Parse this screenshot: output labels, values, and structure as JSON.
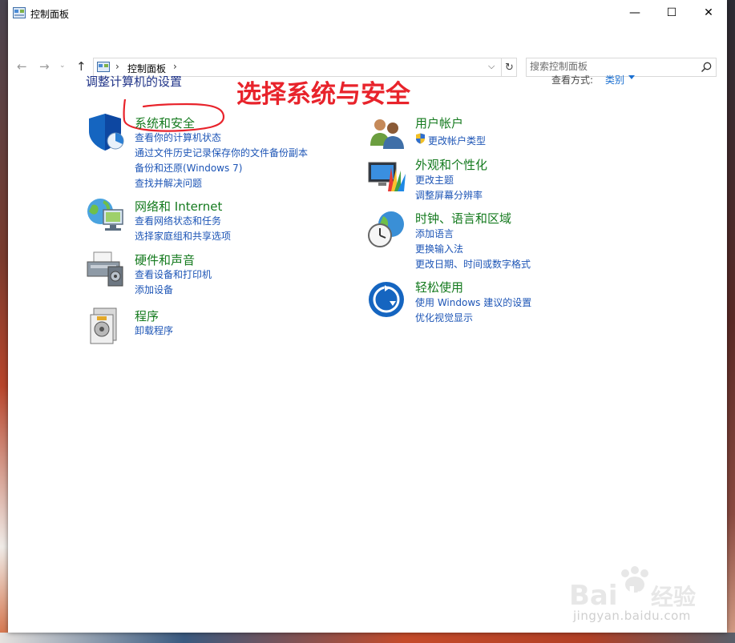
{
  "window": {
    "title": "控制面板",
    "controls": {
      "minimize": "—",
      "maximize": "☐",
      "close": "✕"
    }
  },
  "address": {
    "path": "控制面板",
    "search_placeholder": "搜索控制面板"
  },
  "main": {
    "heading": "调整计算机的设置",
    "view_by_label": "查看方式:",
    "view_by_value": "类别"
  },
  "annotation": {
    "text": "选择系统与安全",
    "color": "#e8232b"
  },
  "categories": [
    {
      "icon": "shield-icon",
      "title": "系统和安全",
      "links": [
        "查看你的计算机状态",
        "通过文件历史记录保存你的文件备份副本",
        "备份和还原(Windows 7)",
        "查找并解决问题"
      ]
    },
    {
      "icon": "network-globe-icon",
      "title": "网络和 Internet",
      "links": [
        "查看网络状态和任务",
        "选择家庭组和共享选项"
      ]
    },
    {
      "icon": "printer-icon",
      "title": "硬件和声音",
      "links": [
        "查看设备和打印机",
        "添加设备"
      ]
    },
    {
      "icon": "programs-icon",
      "title": "程序",
      "links": [
        "卸载程序"
      ]
    },
    {
      "icon": "users-icon",
      "title": "用户帐户",
      "links": [
        "更改帐户类型"
      ]
    },
    {
      "icon": "display-color-icon",
      "title": "外观和个性化",
      "links": [
        "更改主题",
        "调整屏幕分辨率"
      ]
    },
    {
      "icon": "clock-globe-icon",
      "title": "时钟、语言和区域",
      "links": [
        "添加语言",
        "更换输入法",
        "更改日期、时间或数字格式"
      ]
    },
    {
      "icon": "ease-of-access-icon",
      "title": "轻松使用",
      "links": [
        "使用 Windows 建议的设置",
        "优化视觉显示"
      ]
    }
  ],
  "watermark": {
    "text": "jingyan.baidu.com"
  },
  "colors": {
    "title_green": "#147a1e",
    "link_blue": "#1d55b6",
    "heading_blue": "#1e3287"
  }
}
